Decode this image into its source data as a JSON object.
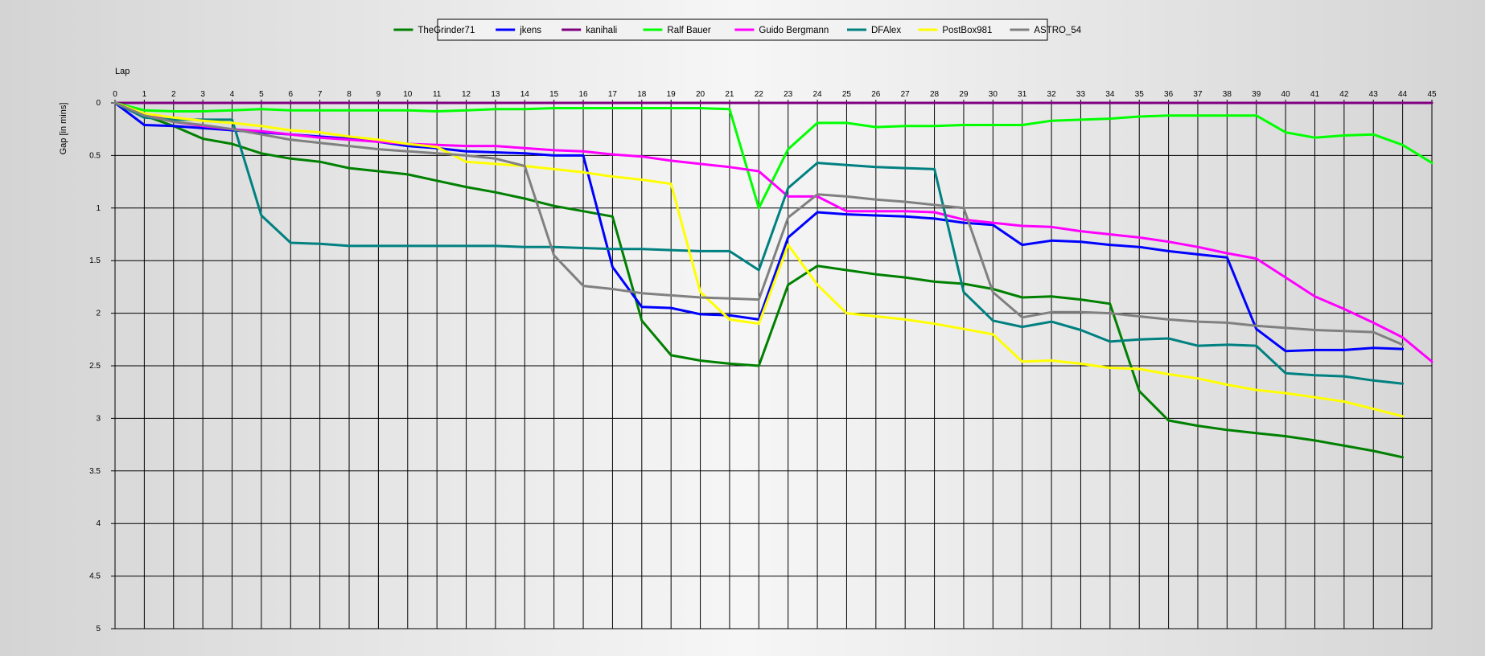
{
  "chart_data": {
    "type": "line",
    "xlabel": "Lap",
    "ylabel": "Gap [in mins]",
    "xlim": [
      0,
      45
    ],
    "ylim": [
      0,
      5
    ],
    "y_inverted": true,
    "x_ticks": [
      0,
      1,
      2,
      3,
      4,
      5,
      6,
      7,
      8,
      9,
      10,
      11,
      12,
      13,
      14,
      15,
      16,
      17,
      18,
      19,
      20,
      21,
      22,
      23,
      24,
      25,
      26,
      27,
      28,
      29,
      30,
      31,
      32,
      33,
      34,
      35,
      36,
      37,
      38,
      39,
      40,
      41,
      42,
      43,
      44,
      45
    ],
    "y_ticks": [
      {
        "v": 0,
        "label": "0"
      },
      {
        "v": 0.5,
        "label": "0.5"
      },
      {
        "v": 1,
        "label": "1"
      },
      {
        "v": 1.5,
        "label": "1.5"
      },
      {
        "v": 2,
        "label": "2"
      },
      {
        "v": 2.5,
        "label": "2.5"
      },
      {
        "v": 3,
        "label": "3"
      },
      {
        "v": 3.5,
        "label": "3.5"
      },
      {
        "v": 4,
        "label": "4"
      },
      {
        "v": 4.5,
        "label": "4.5"
      },
      {
        "v": 5,
        "label": "5"
      }
    ],
    "grid": true,
    "legend_position": "top-center",
    "series": [
      {
        "name": "TheGrinder71",
        "color": "#008000",
        "values": [
          0,
          0.12,
          0.22,
          0.34,
          0.39,
          0.48,
          0.53,
          0.56,
          0.62,
          0.65,
          0.68,
          0.74,
          0.8,
          0.85,
          0.91,
          0.98,
          1.03,
          1.08,
          2.07,
          2.4,
          2.45,
          2.48,
          2.5,
          1.73,
          1.55,
          1.59,
          1.63,
          1.66,
          1.7,
          1.72,
          1.77,
          1.85,
          1.84,
          1.87,
          1.91,
          2.74,
          3.02,
          3.07,
          3.11,
          3.14,
          3.17,
          3.21,
          3.26,
          3.31,
          3.37
        ]
      },
      {
        "name": "jkens",
        "color": "#0000ff",
        "values": [
          0,
          0.21,
          0.22,
          0.24,
          0.26,
          0.28,
          0.3,
          0.32,
          0.34,
          0.37,
          0.41,
          0.43,
          0.46,
          0.47,
          0.48,
          0.5,
          0.5,
          1.56,
          1.94,
          1.95,
          2.01,
          2.02,
          2.06,
          1.28,
          1.04,
          1.06,
          1.07,
          1.08,
          1.1,
          1.14,
          1.16,
          1.35,
          1.31,
          1.32,
          1.35,
          1.37,
          1.41,
          1.44,
          1.47,
          2.15,
          2.36,
          2.35,
          2.35,
          2.33,
          2.34
        ]
      },
      {
        "name": "kanihali",
        "color": "#800080",
        "values": [
          0,
          0,
          0,
          0,
          0,
          0,
          0,
          0,
          0,
          0,
          0,
          0,
          0,
          0,
          0,
          0,
          0,
          0,
          0,
          0,
          0,
          0,
          0,
          0,
          0,
          0,
          0,
          0,
          0,
          0,
          0,
          0,
          0,
          0,
          0,
          0,
          0,
          0,
          0,
          0,
          0,
          0,
          0,
          0,
          0,
          0
        ]
      },
      {
        "name": "Ralf Bauer",
        "color": "#00ff00",
        "values": [
          0,
          0.07,
          0.08,
          0.08,
          0.07,
          0.06,
          0.07,
          0.07,
          0.07,
          0.07,
          0.07,
          0.08,
          0.07,
          0.06,
          0.06,
          0.05,
          0.05,
          0.05,
          0.05,
          0.05,
          0.05,
          0.06,
          1.0,
          0.44,
          0.19,
          0.19,
          0.23,
          0.22,
          0.22,
          0.21,
          0.21,
          0.21,
          0.17,
          0.16,
          0.15,
          0.13,
          0.12,
          0.12,
          0.12,
          0.12,
          0.28,
          0.33,
          0.31,
          0.3,
          0.4,
          0.57
        ]
      },
      {
        "name": "Guido Bergmann",
        "color": "#ff00ff",
        "values": [
          0,
          0.1,
          0.18,
          0.22,
          0.25,
          0.27,
          0.3,
          0.33,
          0.35,
          0.37,
          0.39,
          0.4,
          0.41,
          0.41,
          0.43,
          0.45,
          0.46,
          0.49,
          0.51,
          0.55,
          0.58,
          0.61,
          0.65,
          0.89,
          0.89,
          1.03,
          1.03,
          1.03,
          1.04,
          1.11,
          1.14,
          1.17,
          1.18,
          1.22,
          1.25,
          1.28,
          1.32,
          1.37,
          1.43,
          1.48,
          1.66,
          1.84,
          1.96,
          2.09,
          2.23,
          2.46
        ]
      },
      {
        "name": "DFAlex",
        "color": "#008080",
        "values": [
          0,
          0.14,
          0.16,
          0.16,
          0.16,
          1.07,
          1.33,
          1.34,
          1.36,
          1.36,
          1.36,
          1.36,
          1.36,
          1.36,
          1.37,
          1.37,
          1.38,
          1.39,
          1.39,
          1.4,
          1.41,
          1.41,
          1.59,
          0.81,
          0.57,
          0.59,
          0.61,
          0.62,
          0.63,
          1.8,
          2.07,
          2.13,
          2.08,
          2.16,
          2.27,
          2.25,
          2.24,
          2.31,
          2.3,
          2.31,
          2.57,
          2.59,
          2.6,
          2.64,
          2.67
        ]
      },
      {
        "name": "PostBox981",
        "color": "#ffff00",
        "values": [
          0,
          0.1,
          0.14,
          0.17,
          0.19,
          0.22,
          0.26,
          0.28,
          0.32,
          0.35,
          0.39,
          0.42,
          0.56,
          0.58,
          0.6,
          0.63,
          0.66,
          0.7,
          0.73,
          0.77,
          1.8,
          2.06,
          2.1,
          1.35,
          1.73,
          2.0,
          2.03,
          2.06,
          2.1,
          2.15,
          2.2,
          2.46,
          2.45,
          2.48,
          2.52,
          2.53,
          2.58,
          2.62,
          2.68,
          2.73,
          2.76,
          2.8,
          2.84,
          2.91,
          2.98
        ]
      },
      {
        "name": "ASTRO_54",
        "color": "#808080",
        "values": [
          0,
          0.12,
          0.18,
          0.21,
          0.25,
          0.3,
          0.35,
          0.38,
          0.41,
          0.44,
          0.46,
          0.48,
          0.5,
          0.53,
          0.6,
          1.45,
          1.74,
          1.77,
          1.81,
          1.83,
          1.85,
          1.86,
          1.87,
          1.09,
          0.87,
          0.89,
          0.92,
          0.94,
          0.97,
          1.0,
          1.8,
          2.04,
          1.99,
          1.99,
          2.0,
          2.03,
          2.06,
          2.08,
          2.09,
          2.12,
          2.14,
          2.16,
          2.17,
          2.18,
          2.3
        ]
      }
    ]
  }
}
